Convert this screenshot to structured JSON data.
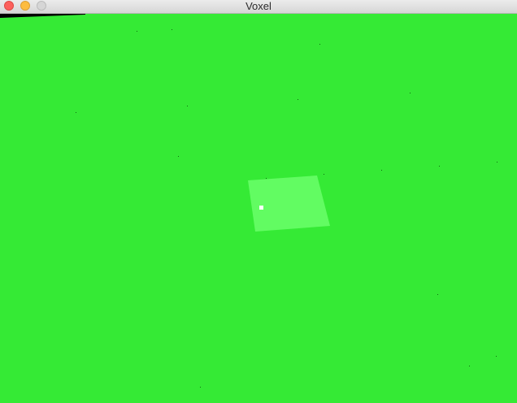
{
  "window": {
    "title": "Voxel"
  },
  "scene": {
    "ground_color": "#35ea35",
    "selected_face_color": "#62fc62",
    "crosshair_color": "#ffffff",
    "speck_color": "#0f6a0f",
    "horizon_color": "#000000"
  }
}
